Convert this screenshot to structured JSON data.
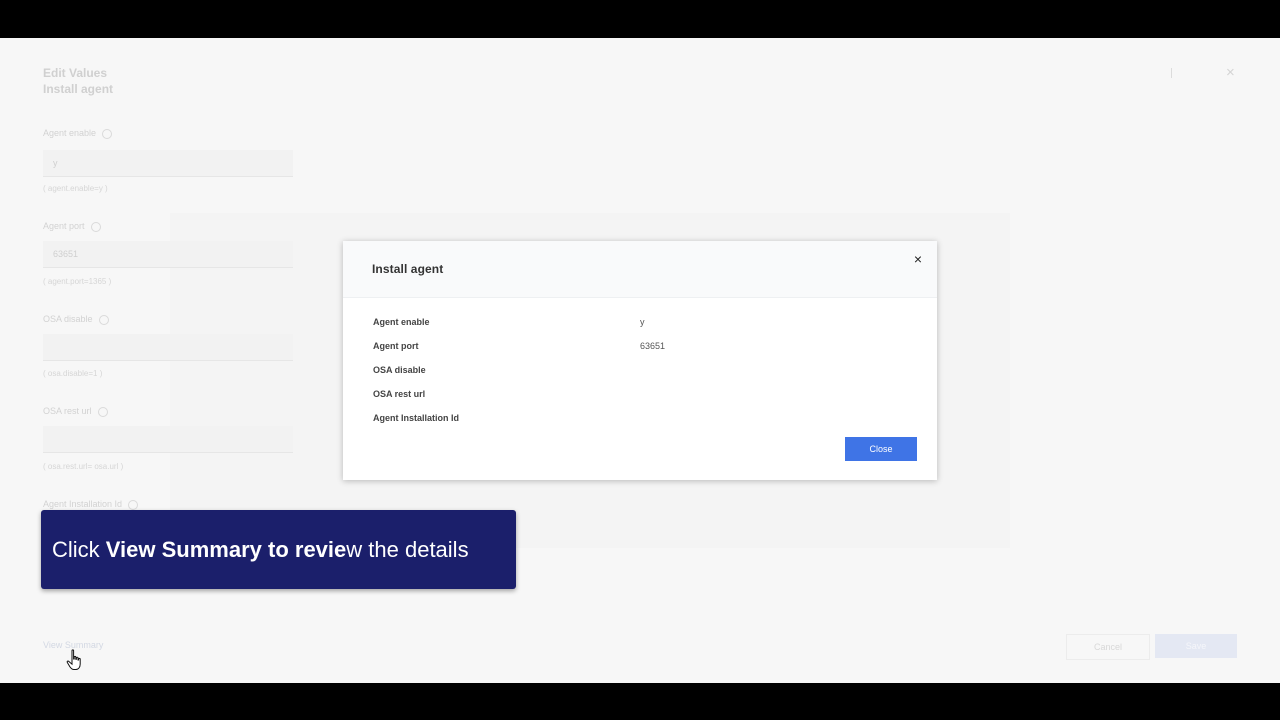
{
  "background_form": {
    "title_line1": "Edit Values",
    "title_line2": "Install agent",
    "fields": [
      {
        "label": "Agent enable",
        "value": "y",
        "hint": "( agent.enable=y )"
      },
      {
        "label": "Agent port",
        "value": "63651",
        "hint": "( agent.port=1365 )"
      },
      {
        "label": "OSA disable",
        "value": "",
        "hint": "( osa.disable=1 )"
      },
      {
        "label": "OSA rest url",
        "value": "",
        "hint": "( osa.rest.url= osa.url )"
      },
      {
        "label": "Agent Installation Id",
        "value": "",
        "hint": ""
      }
    ],
    "view_summary_link": "View Summary",
    "cancel_label": "Cancel",
    "save_label": "Save"
  },
  "modal": {
    "title": "Install agent",
    "close_icon": "×",
    "rows": [
      {
        "key": "Agent enable",
        "value": "y"
      },
      {
        "key": "Agent port",
        "value": "63651"
      },
      {
        "key": "OSA disable",
        "value": ""
      },
      {
        "key": "OSA rest url",
        "value": ""
      },
      {
        "key": "Agent Installation Id",
        "value": ""
      }
    ],
    "close_button": "Close"
  },
  "caption": {
    "part1": "Click ",
    "part2": "View Summary to revie",
    "part3": "w the details"
  },
  "colors": {
    "primary": "#3f74e6",
    "caption_bg": "#1b1f6b"
  },
  "icons": {
    "modal_close": "close-icon",
    "pointer": "hand-cursor-icon"
  }
}
